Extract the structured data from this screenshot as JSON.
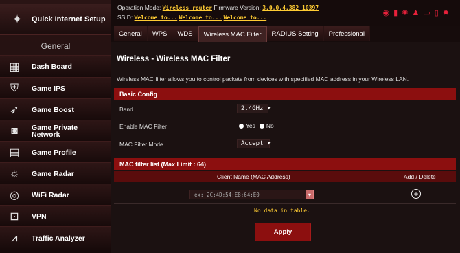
{
  "sidebar": {
    "quick_setup": "Quick Internet Setup",
    "section": "General",
    "items": [
      {
        "label": "Dash Board",
        "icon": "dashboard-icon"
      },
      {
        "label": "Game IPS",
        "icon": "shield-icon"
      },
      {
        "label": "Game Boost",
        "icon": "rocket-icon"
      },
      {
        "label": "Game Private Network",
        "icon": "network-icon"
      },
      {
        "label": "Game Profile",
        "icon": "profile-icon"
      },
      {
        "label": "Game Radar",
        "icon": "radar-icon"
      },
      {
        "label": "WiFi Radar",
        "icon": "wifi-radar-icon"
      },
      {
        "label": "VPN",
        "icon": "vpn-icon"
      },
      {
        "label": "Traffic Analyzer",
        "icon": "traffic-icon"
      }
    ]
  },
  "header": {
    "op_label": "Operation Mode:",
    "op_value": "Wireless router",
    "fw_label": "Firmware Version:",
    "fw_value": "3.0.0.4.382_10397",
    "ssid_label": "SSID:",
    "ssid_values": [
      "Welcome to...",
      "Welcome to...",
      "Welcome to..."
    ]
  },
  "tabs": [
    "General",
    "WPS",
    "WDS",
    "Wireless MAC Filter",
    "RADIUS Setting",
    "Professional"
  ],
  "page": {
    "title": "Wireless - Wireless MAC Filter",
    "description": "Wireless MAC filter allows you to control packets from devices with specified MAC address in your Wireless LAN."
  },
  "basic": {
    "header": "Basic Config",
    "band_label": "Band",
    "band_value": "2.4GHz",
    "enable_label": "Enable MAC Filter",
    "yes": "Yes",
    "no": "No",
    "mode_label": "MAC Filter Mode",
    "mode_value": "Accept"
  },
  "list": {
    "header": "MAC filter list (Max Limit : 64)",
    "col_client": "Client Name (MAC Address)",
    "col_action": "Add / Delete",
    "placeholder": "ex: 2C:4D:54:E8:64:E0",
    "empty": "No data in table."
  },
  "apply_label": "Apply",
  "colors": {
    "accent": "#8c0f0f",
    "highlight": "#ffcc33"
  }
}
